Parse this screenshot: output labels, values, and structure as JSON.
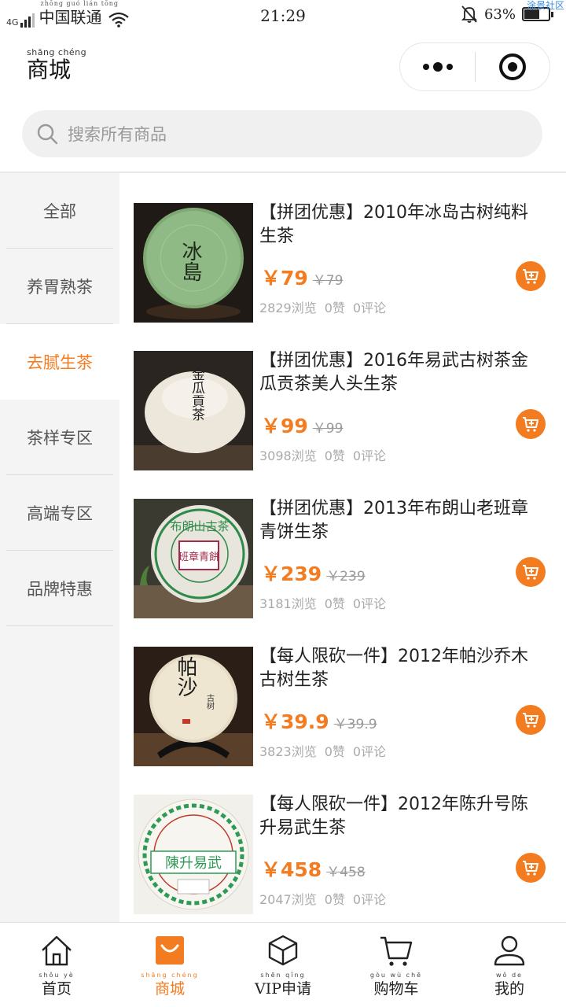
{
  "status_bar": {
    "network": "4G",
    "carrier": "中国联通",
    "carrier_pinyin": "zhōng guó lián tōng",
    "time": "21:29",
    "battery_text": "63%",
    "battery_level": 0.63,
    "watermark": "涂景社区"
  },
  "header": {
    "title": "商城",
    "title_pinyin": "shāng chéng",
    "more_icon": "more-dots-icon",
    "close_icon": "record-circle-icon"
  },
  "search": {
    "placeholder": "搜索所有商品",
    "icon": "search-icon"
  },
  "sidebar": {
    "items": [
      {
        "label": "全部",
        "active": false
      },
      {
        "label": "养胃熟茶",
        "active": false
      },
      {
        "label": "去腻生茶",
        "active": true
      },
      {
        "label": "茶样专区",
        "active": false
      },
      {
        "label": "高端专区",
        "active": false
      },
      {
        "label": "品牌特惠",
        "active": false
      }
    ]
  },
  "products": [
    {
      "title": "【拼团优惠】2010年冰岛古树纯料生茶",
      "price": "￥79",
      "original_price": "￥79",
      "views": "2829浏览",
      "likes": "0赞",
      "comments": "0评论"
    },
    {
      "title": "【拼团优惠】2016年易武古树茶金瓜贡茶美人头生茶",
      "price": "￥99",
      "original_price": "￥99",
      "views": "3098浏览",
      "likes": "0赞",
      "comments": "0评论"
    },
    {
      "title": "【拼团优惠】2013年布朗山老班章青饼生茶",
      "price": "￥239",
      "original_price": "￥239",
      "views": "3181浏览",
      "likes": "0赞",
      "comments": "0评论"
    },
    {
      "title": "【每人限砍一件】2012年帕沙乔木古树生茶",
      "price": "￥39.9",
      "original_price": "￥39.9",
      "views": "3823浏览",
      "likes": "0赞",
      "comments": "0评论"
    },
    {
      "title": "【每人限砍一件】2012年陈升号陈升易武生茶",
      "price": "￥458",
      "original_price": "￥458",
      "views": "2047浏览",
      "likes": "0赞",
      "comments": "0评论"
    }
  ],
  "product_images": {
    "p1_text": "冰島",
    "p2_text": "金瓜貢茶",
    "p3_text": "布朗山古茶",
    "p3_stamp": "班章青餅",
    "p4_text": "帕沙",
    "p4_sub": "古树",
    "p5_text": "陳升易武"
  },
  "tabbar": {
    "tabs": [
      {
        "label": "首页",
        "pinyin": "shǒu yè",
        "icon": "home-icon",
        "active": false
      },
      {
        "label": "商城",
        "pinyin": "shāng chéng",
        "icon": "shopping-bag-icon",
        "active": true
      },
      {
        "label": "VIP申请",
        "pinyin": "shēn qǐng",
        "icon": "cube-icon",
        "active": false
      },
      {
        "label": "购物车",
        "pinyin": "gòu wù chē",
        "icon": "cart-icon",
        "active": false
      },
      {
        "label": "我的",
        "pinyin": "wǒ de",
        "icon": "user-icon",
        "active": false
      }
    ]
  },
  "colors": {
    "accent": "#f47c20",
    "sidebar_bg": "#f4f4f4",
    "search_bg": "#f0f0f0"
  }
}
